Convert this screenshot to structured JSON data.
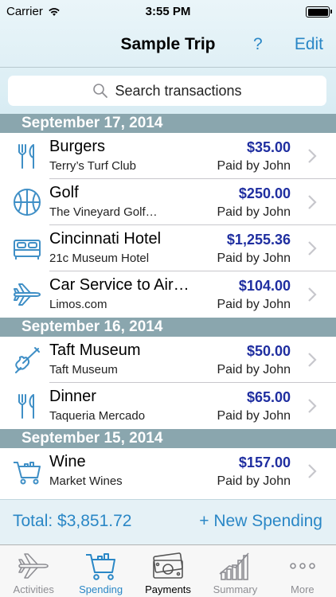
{
  "status": {
    "carrier": "Carrier",
    "time": "3:55 PM"
  },
  "nav": {
    "title": "Sample Trip",
    "help": "?",
    "edit": "Edit"
  },
  "search": {
    "placeholder": "Search transactions"
  },
  "sections": [
    {
      "date": "September 17, 2014",
      "items": [
        {
          "icon": "fork-knife-icon",
          "title": "Burgers",
          "subtitle": "Terry’s Turf Club",
          "amount": "$35.00",
          "paid": "Paid by John"
        },
        {
          "icon": "basketball-icon",
          "title": "Golf",
          "subtitle": "The Vineyard Golf…",
          "amount": "$250.00",
          "paid": "Paid by John"
        },
        {
          "icon": "bed-icon",
          "title": "Cincinnati Hotel",
          "subtitle": "21c Museum Hotel",
          "amount": "$1,255.36",
          "paid": "Paid by John"
        },
        {
          "icon": "airplane-icon",
          "title": "Car Service to Air…",
          "subtitle": "Limos.com",
          "amount": "$104.00",
          "paid": "Paid by John"
        }
      ]
    },
    {
      "date": "September 16, 2014",
      "items": [
        {
          "icon": "violin-icon",
          "title": "Taft Museum",
          "subtitle": "Taft Museum",
          "amount": "$50.00",
          "paid": "Paid by John"
        },
        {
          "icon": "fork-knife-icon",
          "title": "Dinner",
          "subtitle": "Taqueria Mercado",
          "amount": "$65.00",
          "paid": "Paid by John"
        }
      ]
    },
    {
      "date": "September 15, 2014",
      "items": [
        {
          "icon": "shopping-cart-icon",
          "title": "Wine",
          "subtitle": "Market Wines",
          "amount": "$157.00",
          "paid": "Paid by John"
        }
      ]
    }
  ],
  "footer": {
    "total": "Total: $3,851.72",
    "new_spending": "+ New Spending"
  },
  "tabs": [
    {
      "label": "Activities",
      "icon": "airplane-icon",
      "state": "inactive"
    },
    {
      "label": "Spending",
      "icon": "shopping-cart-icon",
      "state": "active"
    },
    {
      "label": "Payments",
      "icon": "money-icon",
      "state": "dark"
    },
    {
      "label": "Summary",
      "icon": "bar-chart-icon",
      "state": "inactive"
    },
    {
      "label": "More",
      "icon": "more-dots-icon",
      "state": "inactive"
    }
  ],
  "colors": {
    "accent": "#2a87c6",
    "amount": "#1f2ea0",
    "section": "#8aa6ae",
    "icon": "#3f8fc6"
  }
}
